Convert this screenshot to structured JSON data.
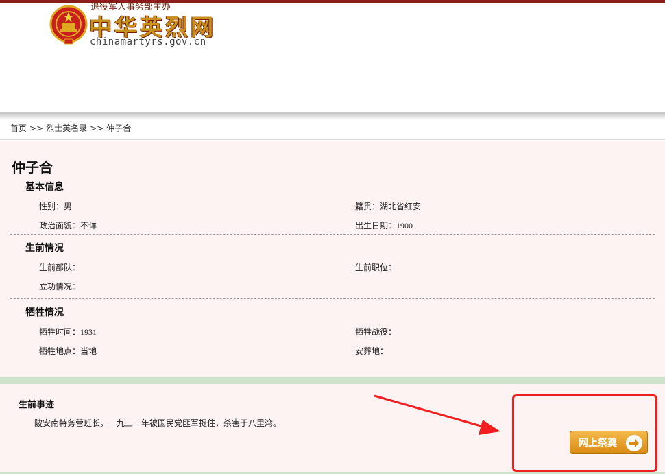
{
  "header": {
    "logo_top_text": "退役军人事务部主办",
    "logo_title": "中华英烈网",
    "logo_url": "chinamartyrs.gov.cn"
  },
  "breadcrumb": {
    "home": "首页",
    "sep1": ">>",
    "list": "烈士英名录",
    "sep2": ">>",
    "current": "仲子合"
  },
  "person": {
    "name": "仲子合"
  },
  "basic_info": {
    "title": "基本信息",
    "gender": "性别：男",
    "native_place": "籍贯：湖北省红安",
    "political": "政治面貌：不详",
    "birth_date_label": "出生日期：",
    "birth_date": "1900"
  },
  "pre_death": {
    "title": "生前情况",
    "unit": "生前部队：",
    "position": "生前职位：",
    "merit": "立功情况："
  },
  "sacrifice": {
    "title": "牺牲情况",
    "time_label": "牺牲时间：",
    "time": "1931",
    "battle": "牺牲战役：",
    "place": "牺牲地点：当地",
    "burial": "安葬地："
  },
  "deeds": {
    "title": "生前事迹",
    "text": "陂安南特务营班长，一九三一年被国民党匪军捉住，杀害于八里湾。"
  },
  "actions": {
    "mourn_label": "网上祭奠"
  },
  "colors": {
    "topbar": "#8b1c1c",
    "panel_bg": "#fdf3f3",
    "divider_green": "#cfe3cc",
    "button_orange": "#e39a22",
    "annotation_red": "#f02020"
  }
}
